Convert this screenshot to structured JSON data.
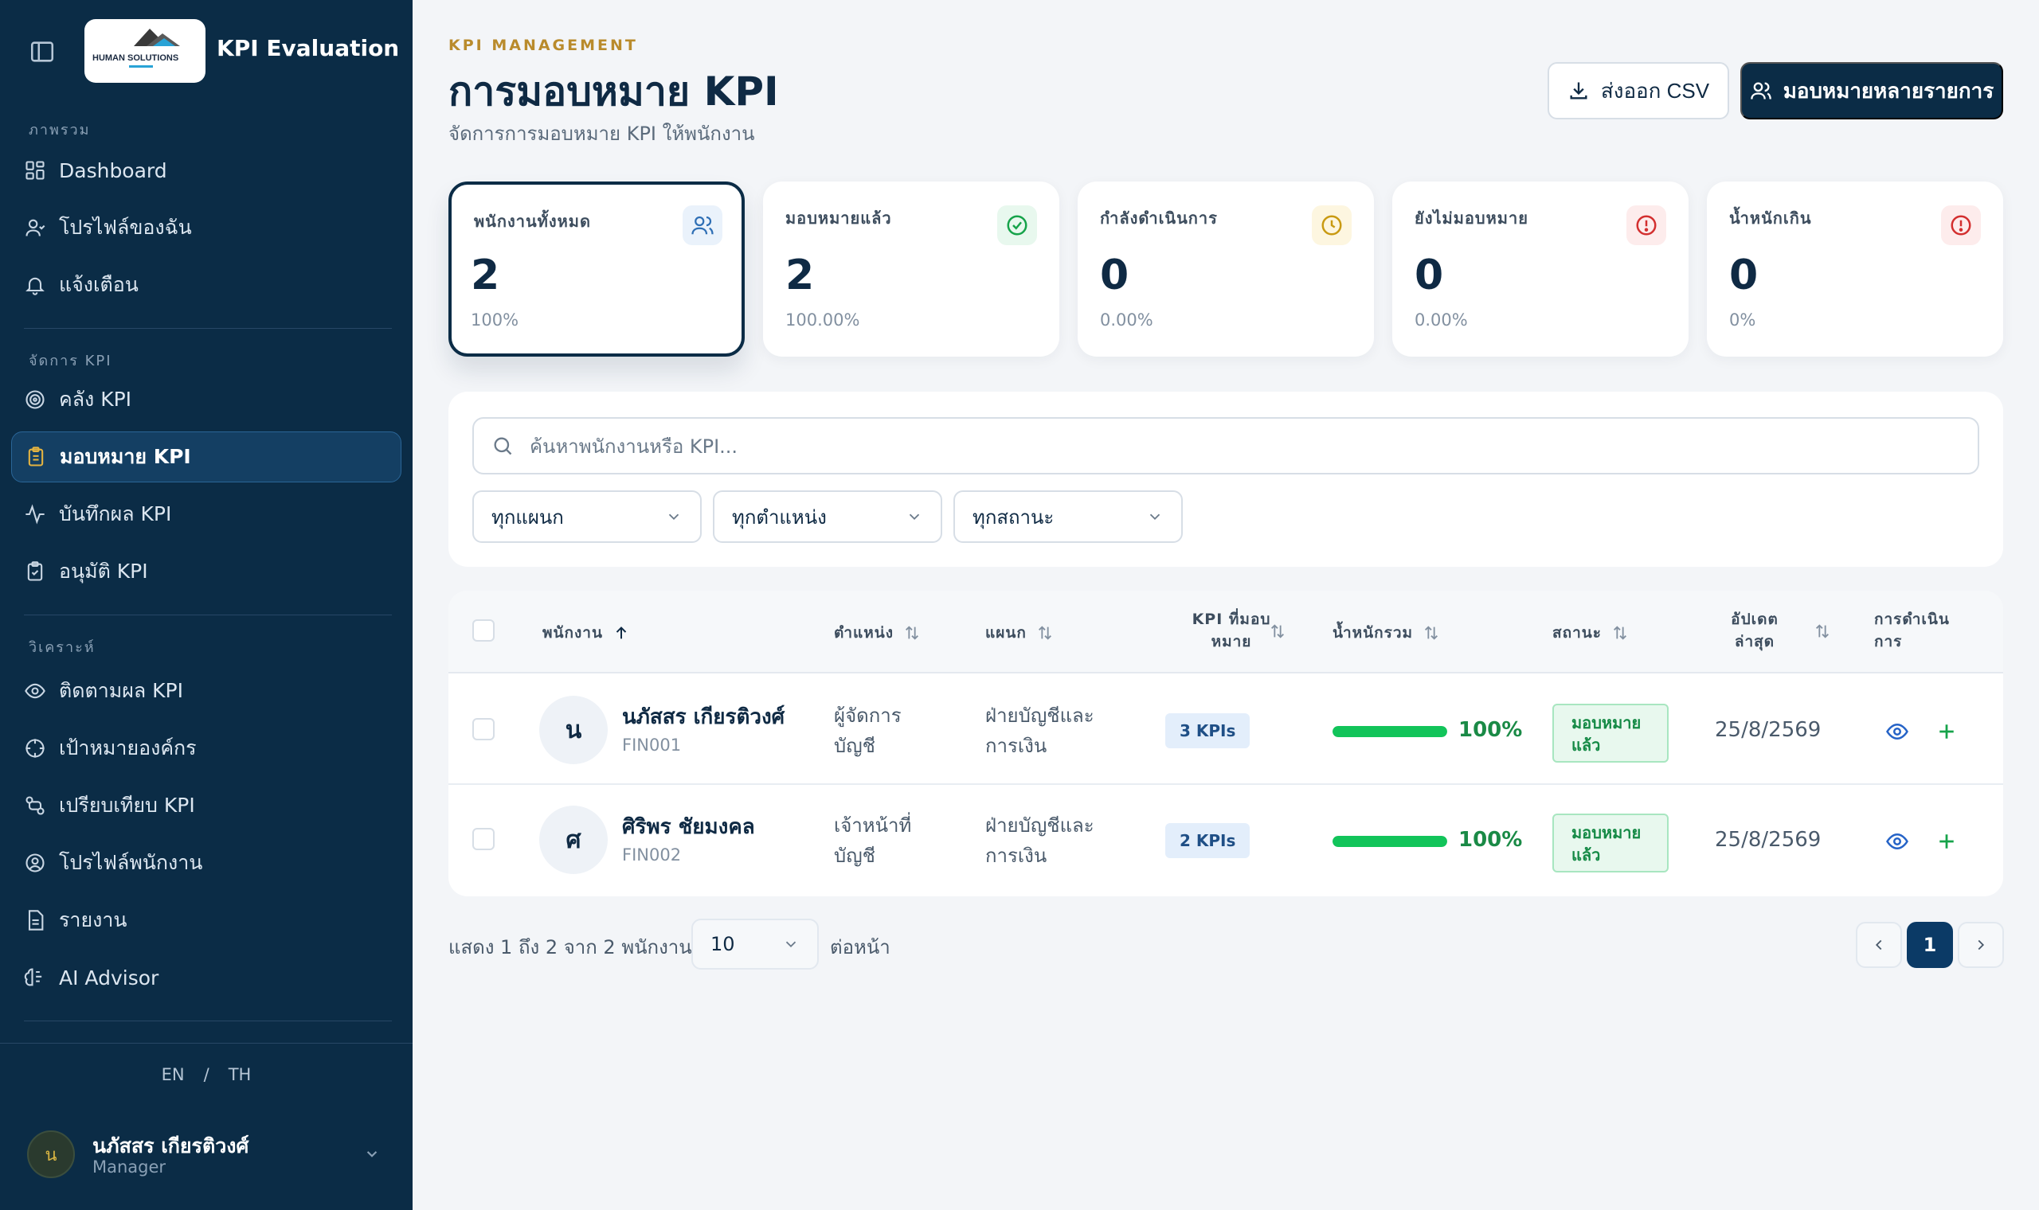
{
  "sidebar": {
    "app_title": "KPI Evaluation ...",
    "logo_text": "HUMAN SOLUTIONS",
    "sections": {
      "overview": "ภาพรวม",
      "manage": "จัดการ KPI",
      "analyze": "วิเคราะห์"
    },
    "items": [
      {
        "label": "Dashboard",
        "icon": "grid-icon"
      },
      {
        "label": "โปรไฟล์ของฉัน",
        "icon": "user-icon"
      },
      {
        "label": "แจ้งเตือน",
        "icon": "bell-icon"
      },
      {
        "label": "คลัง KPI",
        "icon": "target-icon"
      },
      {
        "label": "มอบหมาย KPI",
        "icon": "clipboard-icon",
        "active": true
      },
      {
        "label": "บันทึกผล KPI",
        "icon": "activity-icon"
      },
      {
        "label": "อนุมัติ KPI",
        "icon": "clipboard-check-icon"
      },
      {
        "label": "ติดตามผล KPI",
        "icon": "eye-icon"
      },
      {
        "label": "เป้าหมายองค์กร",
        "icon": "crosshair-icon"
      },
      {
        "label": "เปรียบเทียบ KPI",
        "icon": "compare-icon"
      },
      {
        "label": "โปรไฟล์พนักงาน",
        "icon": "user-circle-icon"
      },
      {
        "label": "รายงาน",
        "icon": "file-icon"
      },
      {
        "label": "AI Advisor",
        "icon": "brain-icon"
      }
    ],
    "lang": {
      "en": "EN",
      "sep": "/",
      "th": "TH"
    },
    "user": {
      "initial": "น",
      "name": "นภัสสร เกียรติวงศ์",
      "role": "Manager"
    }
  },
  "header": {
    "eyebrow": "KPI MANAGEMENT",
    "title": "การมอบหมาย KPI",
    "subtitle": "จัดการการมอบหมาย KPI ให้พนักงาน",
    "export_label": "ส่งออก CSV",
    "bulk_assign_label": "มอบหมายหลายรายการ"
  },
  "stats": [
    {
      "label": "พนักงานทั้งหมด",
      "value": "2",
      "pct": "100%",
      "color": "#2f6fb5",
      "bg": "#eaf2fb"
    },
    {
      "label": "มอบหมายแล้ว",
      "value": "2",
      "pct": "100.00%",
      "color": "#16a34a",
      "bg": "#e8f8ee"
    },
    {
      "label": "กำลังดำเนินการ",
      "value": "0",
      "pct": "0.00%",
      "color": "#c99a12",
      "bg": "#fdf6e0"
    },
    {
      "label": "ยังไม่มอบหมาย",
      "value": "0",
      "pct": "0.00%",
      "color": "#d32f2f",
      "bg": "#fdecec"
    },
    {
      "label": "น้ำหนักเกิน",
      "value": "0",
      "pct": "0%",
      "color": "#d32f2f",
      "bg": "#fdecec"
    }
  ],
  "filters": {
    "search_placeholder": "ค้นหาพนักงานหรือ KPI...",
    "department": "ทุกแผนก",
    "position": "ทุกตำแหน่ง",
    "status": "ทุกสถานะ"
  },
  "table": {
    "columns": {
      "employee": "พนักงาน",
      "position": "ตำแหน่ง",
      "department": "แผนก",
      "kpi_line1": "KPI ที่มอบ",
      "kpi_line2": "หมาย",
      "weight": "น้ำหนักรวม",
      "status": "สถานะ",
      "updated_line1": "อัปเดต",
      "updated_line2": "ล่าสุด",
      "actions_line1": "การดำเนิน",
      "actions_line2": "การ"
    },
    "rows": [
      {
        "initial": "น",
        "name": "นภัสสร เกียรติวงศ์",
        "code": "FIN001",
        "position_l1": "ผู้จัดการ",
        "position_l2": "บัญชี",
        "dept_l1": "ฝ่ายบัญชีและ",
        "dept_l2": "การเงิน",
        "kpis": "3 KPIs",
        "weight": "100%",
        "weight_value": 100,
        "status_l1": "มอบหมาย",
        "status_l2": "แล้ว",
        "updated": "25/8/2569"
      },
      {
        "initial": "ศ",
        "name": "ศิริพร ชัยมงคล",
        "code": "FIN002",
        "position_l1": "เจ้าหน้าที่",
        "position_l2": "บัญชี",
        "dept_l1": "ฝ่ายบัญชีและ",
        "dept_l2": "การเงิน",
        "kpis": "2 KPIs",
        "weight": "100%",
        "weight_value": 100,
        "status_l1": "มอบหมาย",
        "status_l2": "แล้ว",
        "updated": "25/8/2569"
      }
    ]
  },
  "pagination": {
    "info": "แสดง 1 ถึง 2 จาก 2 พนักงาน",
    "per_page": "10",
    "per_page_label": "ต่อหน้า",
    "current_page": "1"
  }
}
